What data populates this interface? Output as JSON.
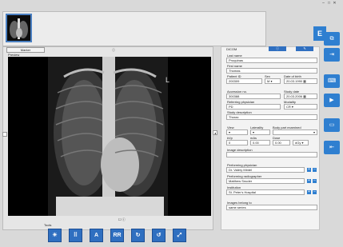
{
  "window": {
    "min": "–",
    "max": "□",
    "close": "✕"
  },
  "viewer": {
    "marker_button": "Marker",
    "checkbox_label": "ⓘ",
    "preview_label": "Preview",
    "bottom_check": "☐ ⓘ"
  },
  "tools": {
    "label": "Tools",
    "items": [
      {
        "icon": "brightness-icon",
        "glyph": "☀"
      },
      {
        "icon": "grid-icon",
        "glyph": "⠿"
      },
      {
        "icon": "flip-vertical-icon",
        "glyph": "A"
      },
      {
        "icon": "flip-horizontal-icon",
        "glyph": "RR"
      },
      {
        "icon": "rotate-right-icon",
        "glyph": "↻"
      },
      {
        "icon": "rotate-left-icon",
        "glyph": "↺"
      },
      {
        "icon": "crop-icon",
        "glyph": "⤢"
      }
    ]
  },
  "dicom": {
    "title": "DICOM",
    "badge": "E",
    "last_name_label": "Last name",
    "last_name": "Proquinas",
    "first_name_label": "First name",
    "first_name": "Thomas",
    "patient_id_label": "Patient ID",
    "patient_id": "200309",
    "sex_label": "Sex",
    "sex": "M",
    "dob_label": "Date of birth",
    "dob": "20.03.1990",
    "accession_label": "Accession no.",
    "accession": "300388",
    "study_date_label": "Study date",
    "study_date": "20.03.2006",
    "ref_phys_label": "Referring physician",
    "ref_phys": "PD",
    "modality_label": "Modality",
    "modality": "CR",
    "study_desc_label": "Study description",
    "study_desc": "Thorax",
    "view_label": "View",
    "laterality_label": "Laterality",
    "body_part_label": "Body part examined",
    "kvp_label": "kVp",
    "mas_label": "mAs",
    "dose_label": "Dose",
    "kvp": "0",
    "mas": "0.00",
    "dose": "0.00",
    "dose_unit": "dGy",
    "image_desc_label": "Image description",
    "perf_phys_label": "Performing physician",
    "perf_phys": "Dr. Valery Mintel",
    "perf_radio_label": "Performing radiographer",
    "perf_radio": "Matthew Snuder",
    "institution_label": "Institution",
    "institution": "St. Peter's Hospital",
    "belongs_label": "Images belong to",
    "belongs": "same series"
  }
}
